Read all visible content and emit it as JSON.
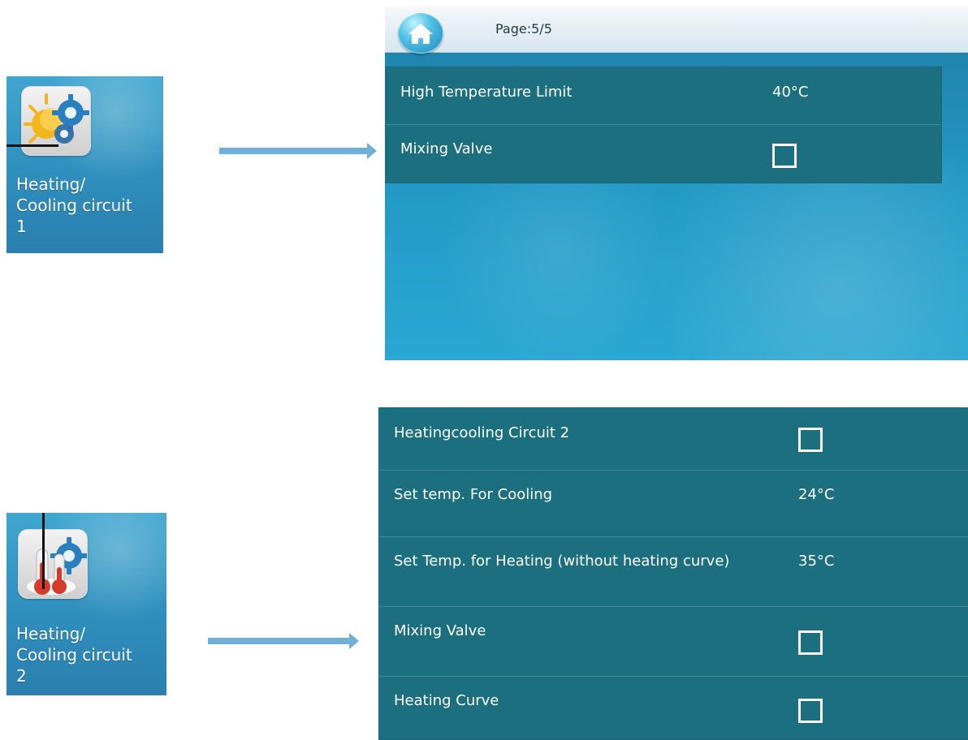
{
  "tile1": {
    "label_lines": [
      "Heating/",
      "Cooling circuit",
      "1"
    ],
    "icon": "weather-sun-gear-icon"
  },
  "tile2": {
    "label_lines": [
      "Heating/",
      "Cooling circuit",
      "2"
    ],
    "icon": "thermometer-gear-icon"
  },
  "screen_top": {
    "home_icon": "home-icon",
    "page": "Page:5/5",
    "rows": [
      {
        "label": "High Temperature Limit",
        "value": "40°C"
      },
      {
        "label": "Mixing Valve",
        "checked": false
      }
    ]
  },
  "screen_bottom": {
    "rows": [
      {
        "label": "Heatingcooling Circuit 2",
        "checked": false
      },
      {
        "label": "Set temp. For Cooling",
        "value": "24°C"
      },
      {
        "label": "Set Temp. for Heating (without heating curve)",
        "value": "35°C"
      },
      {
        "label": "Mixing Valve",
        "checked": false
      },
      {
        "label": "Heating Curve",
        "checked": false
      }
    ]
  },
  "colors": {
    "tile_blue": "#2f8fbd",
    "panel_teal": "#1b6f7f",
    "arrow_blue": "#6fb1d6"
  }
}
